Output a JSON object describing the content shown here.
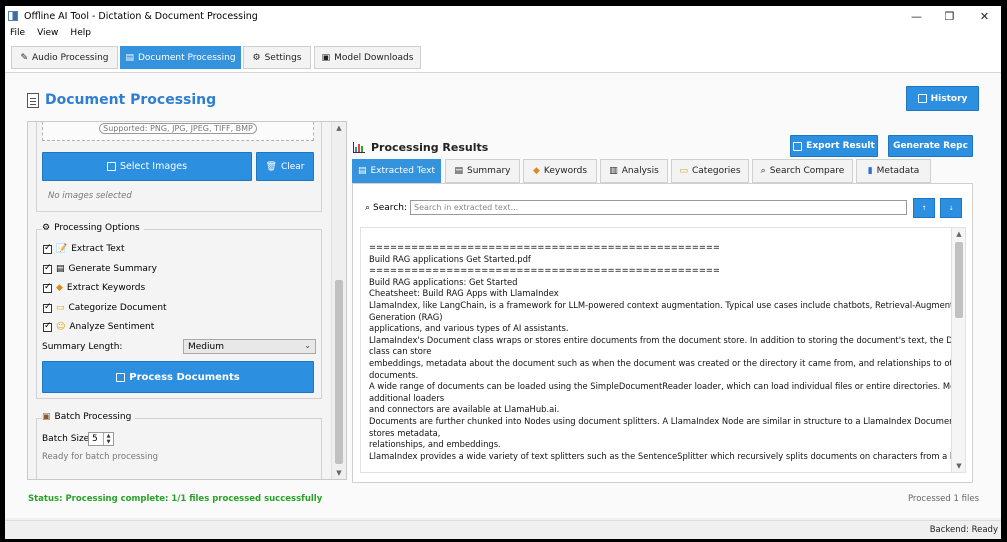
{
  "window": {
    "title": "Offline AI Tool - Dictation & Document Processing"
  },
  "menu": [
    "File",
    "View",
    "Help"
  ],
  "main_tabs": [
    {
      "label": "Audio Processing",
      "icon": "pen-icon"
    },
    {
      "label": "Document Processing",
      "icon": "document-icon",
      "active": true
    },
    {
      "label": "Settings",
      "icon": "gear-icon"
    },
    {
      "label": "Model Downloads",
      "icon": "box-icon"
    }
  ],
  "page": {
    "title": "Document Processing",
    "history_label": "History"
  },
  "left": {
    "supported": "Supported: PNG, JPG, JPEG, TIFF, BMP",
    "select_images": "Select Images",
    "clear": "Clear",
    "no_images": "No images selected",
    "options_title": "Processing Options",
    "options": [
      "Extract Text",
      "Generate Summary",
      "Extract Keywords",
      "Categorize Document",
      "Analyze Sentiment"
    ],
    "summary_length_label": "Summary Length:",
    "summary_length_value": "Medium",
    "process_button": "Process Documents",
    "batch_title": "Batch Processing",
    "batch_size_label": "Batch Size:",
    "batch_size_value": "5",
    "batch_status": "Ready for batch processing"
  },
  "results": {
    "title": "Processing Results",
    "export_label": "Export Result",
    "generate_label": "Generate Repc",
    "tabs": [
      "Extracted Text",
      "Summary",
      "Keywords",
      "Analysis",
      "Categories",
      "Search Compare",
      "Metadata"
    ],
    "search_label": "Search:",
    "search_placeholder": "Search in extracted text...",
    "text": "==================================================\nBuild RAG applications Get Started.pdf\n==================================================\nBuild RAG applications: Get Started\nCheatsheet: Build RAG Apps with LlamaIndex\nLlamaIndex, like LangChain, is a framework for LLM-powered context augmentation. Typical use cases include chatbots, Retrieval-Augmented\nGeneration (RAG)\napplications, and various types of AI assistants.\nLlamaIndex's Document class wraps or stores entire documents from the document store. In addition to storing the document's text, the Document\nclass can store\nembeddings, metadata about the document such as when the document was created or the directory it came from, and relationships to other\ndocuments.\nA wide range of documents can be loaded using the SimpleDocumentReader loader, which can load individual files or entire directories. Moreover,\nadditional loaders\nand connectors are available at LlamaHub.ai.\nDocuments are further chunked into Nodes using document splitters. A LlamaIndex Node are similar in structure to a LlamaIndex Document and also\nstores metadata,\nrelationships, and embeddings.\nLlamaIndex provides a wide variety of text splitters such as the SentenceSplitter which recursively splits documents on characters from a list while"
  },
  "status": {
    "message": "Status: Processing complete: 1/1 files processed successfully",
    "processed": "Processed 1 files",
    "backend": "Backend: Ready"
  }
}
